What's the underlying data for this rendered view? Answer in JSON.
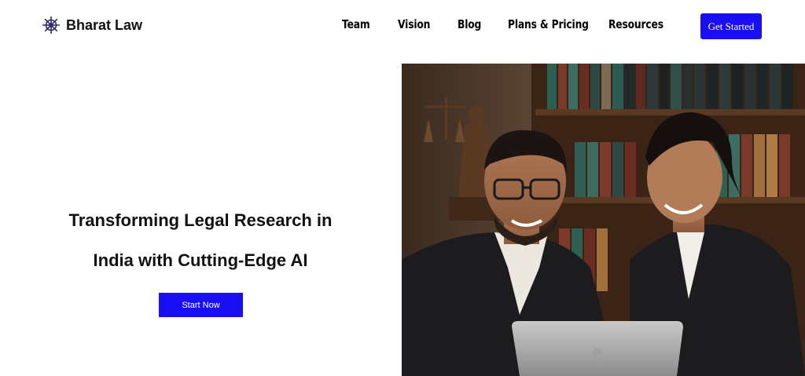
{
  "brand": {
    "name": "Bharat Law",
    "logo_icon": "ship-wheel-icon",
    "logo_color": "#2f2a6b"
  },
  "nav": {
    "items": [
      {
        "label": "Team"
      },
      {
        "label": "Vision"
      },
      {
        "label": "Blog"
      },
      {
        "label": "Plans & Pricing"
      },
      {
        "label": "Resources"
      }
    ],
    "cta_label": "Get Started"
  },
  "hero": {
    "title_line1": "Transforming Legal Research in",
    "title_line2": "India with Cutting-Edge AI",
    "button_label": "Start Now",
    "image": "two-lawyers-looking-at-laptop-photo"
  },
  "colors": {
    "accent": "#1a0ff0",
    "background": "#ffffff",
    "text": "#111111"
  }
}
